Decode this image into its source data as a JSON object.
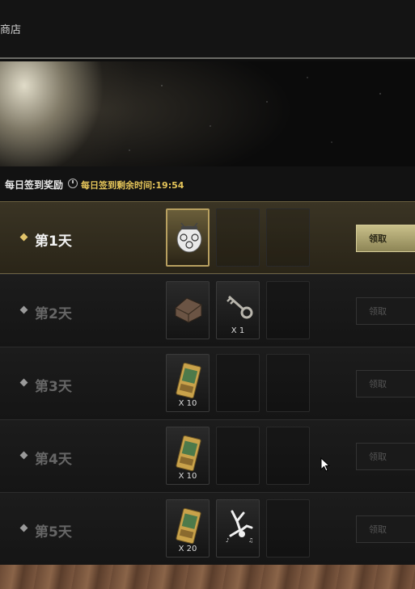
{
  "header": {
    "title": "商店"
  },
  "daily": {
    "label": "每日签到奖励",
    "timer": "每日签到剩余时间:19:54"
  },
  "rows": [
    {
      "day": "第1天",
      "claim": "领取",
      "active": true,
      "items": [
        {
          "icon": "mask-icon",
          "qty": ""
        }
      ]
    },
    {
      "day": "第2天",
      "claim": "领取",
      "active": false,
      "items": [
        {
          "icon": "chest-icon",
          "qty": ""
        },
        {
          "icon": "key-icon",
          "qty": "X 1"
        }
      ]
    },
    {
      "day": "第3天",
      "claim": "领取",
      "active": false,
      "items": [
        {
          "icon": "ticket-icon",
          "qty": "X 10"
        }
      ]
    },
    {
      "day": "第4天",
      "claim": "领取",
      "active": false,
      "items": [
        {
          "icon": "ticket-icon",
          "qty": "X 10"
        }
      ]
    },
    {
      "day": "第5天",
      "claim": "领取",
      "active": false,
      "items": [
        {
          "icon": "ticket-icon",
          "qty": "X 20"
        },
        {
          "icon": "dance-emote-icon",
          "qty": ""
        }
      ]
    }
  ],
  "colors": {
    "accent": "#e6c65a",
    "active_row": "#3a3424",
    "claim_active": "#c9c08a"
  }
}
